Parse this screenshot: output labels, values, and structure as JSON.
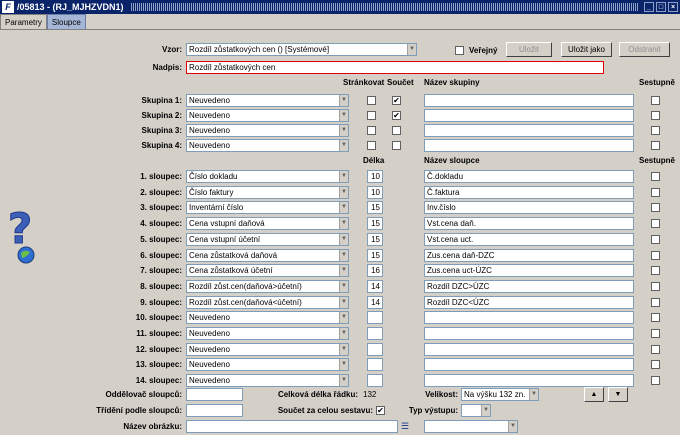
{
  "window": {
    "title": "/05813 - (RJ_MJHZVDN1)"
  },
  "tabs": [
    "Parametry",
    "Sloupce"
  ],
  "vzor": {
    "label": "Vzor:",
    "value": "Rozdíl zůstatkových cen   ()   [Systémové]",
    "verejny_label": "Veřejný",
    "ulozit": "Uložit",
    "ulozit_jako": "Uložit jako",
    "odstranit": "Odstranit"
  },
  "nadpis": {
    "label": "Nadpis:",
    "value": "Rozdíl zůstatkových cen"
  },
  "group_headers": {
    "strankovat": "Stránkovat",
    "soucet": "Součet",
    "nazev": "Název skupiny",
    "sestupne": "Sestupně"
  },
  "groups": [
    {
      "label": "Skupina 1:",
      "value": "Neuvedeno",
      "strankovat": "",
      "soucet": "✔",
      "nazev": "",
      "sestupne": ""
    },
    {
      "label": "Skupina 2:",
      "value": "Neuvedeno",
      "strankovat": "",
      "soucet": "✔",
      "nazev": "",
      "sestupne": ""
    },
    {
      "label": "Skupina 3:",
      "value": "Neuvedeno",
      "strankovat": "",
      "soucet": "",
      "nazev": "",
      "sestupne": ""
    },
    {
      "label": "Skupina 4:",
      "value": "Neuvedeno",
      "strankovat": "",
      "soucet": "",
      "nazev": "",
      "sestupne": ""
    }
  ],
  "col_headers": {
    "delka": "Délka",
    "nazev": "Název sloupce",
    "sestupne": "Sestupně"
  },
  "columns": [
    {
      "label": "1. sloupec:",
      "value": "Číslo dokladu",
      "delka": "10",
      "nazev": "Č.dokladu"
    },
    {
      "label": "2. sloupec:",
      "value": "Číslo faktury",
      "delka": "10",
      "nazev": "Č.faktura"
    },
    {
      "label": "3. sloupec:",
      "value": "Inventární číslo",
      "delka": "15",
      "nazev": "Inv.číslo"
    },
    {
      "label": "4. sloupec:",
      "value": "Cena vstupní daňová",
      "delka": "15",
      "nazev": "Vst.cena daň."
    },
    {
      "label": "5. sloupec:",
      "value": "Cena vstupní účetní",
      "delka": "15",
      "nazev": "Vst.cena uct."
    },
    {
      "label": "6. sloupec:",
      "value": "Cena zůstatková daňová",
      "delka": "15",
      "nazev": "Zus.cena daň-DZC"
    },
    {
      "label": "7. sloupec:",
      "value": "Cena zůstatková účetní",
      "delka": "16",
      "nazev": "Zus.cena uct-ÚZC"
    },
    {
      "label": "8. sloupec:",
      "value": "Rozdíl zůst.cen(daňová>účetní)",
      "delka": "14",
      "nazev": "Rozdíl DZC>ÚZC"
    },
    {
      "label": "9. sloupec:",
      "value": "Rozdíl zůst.cen(daňová<účetní)",
      "delka": "14",
      "nazev": "Rozdíl DZC<ÚZC"
    },
    {
      "label": "10. sloupec:",
      "value": "Neuvedeno",
      "delka": "",
      "nazev": ""
    },
    {
      "label": "11. sloupec:",
      "value": "Neuvedeno",
      "delka": "",
      "nazev": ""
    },
    {
      "label": "12. sloupec:",
      "value": "Neuvedeno",
      "delka": "",
      "nazev": ""
    },
    {
      "label": "13. sloupec:",
      "value": "Neuvedeno",
      "delka": "",
      "nazev": ""
    },
    {
      "label": "14. sloupec:",
      "value": "Neuvedeno",
      "delka": "",
      "nazev": ""
    }
  ],
  "footer": {
    "oddelovac_label": "Oddělovač sloupců:",
    "oddelovac_value": "",
    "celkova_label": "Celková délka řádku:",
    "celkova_value": "132",
    "velikost_label": "Velikost:",
    "velikost_value": "Na výšku 132 zn.",
    "trideni_label": "Třídění podle sloupců:",
    "trideni_value": "",
    "soucet_label": "Součet za celou sestavu:",
    "soucet_value": "✔",
    "typ_label": "Typ výstupu:",
    "typ_value": "",
    "obrazek_label": "Název obrázku:",
    "obrazek_value": "",
    "obrazek_extra": ""
  }
}
